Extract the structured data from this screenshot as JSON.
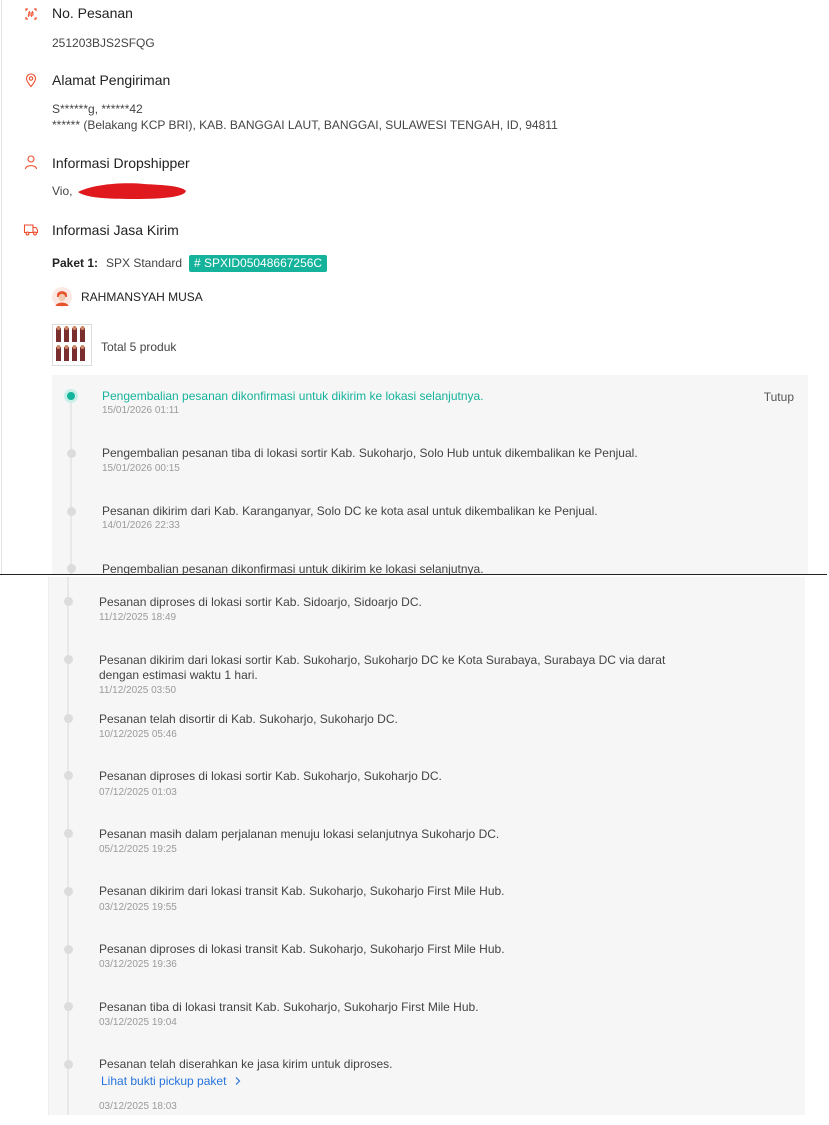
{
  "order": {
    "number_title": "No. Pesanan",
    "number_value": "251203BJS2SFQG",
    "address_title": "Alamat Pengiriman",
    "address_line1": "S******g, ******42",
    "address_line2": "****** (Belakang KCP BRI), KAB. BANGGAI LAUT, BANGGAI, SULAWESI TENGAH, ID, 94811",
    "dropship_title": "Informasi Dropshipper",
    "dropship_value": "Vio,",
    "shipping_title": "Informasi Jasa Kirim",
    "package_label": "Paket 1:",
    "courier": "SPX Standard",
    "tracking_tag": "# SPXID05048667256C",
    "driver_name": "RAHMANSYAH MUSA",
    "product_total": "Total 5 produk",
    "close_label": "Tutup"
  },
  "events_top": [
    {
      "title": "Pengembalian pesanan dikonfirmasi untuk dikirim ke lokasi selanjutnya.",
      "time": "15/01/2026 01:11"
    },
    {
      "title": "Pengembalian pesanan tiba di lokasi sortir Kab. Sukoharjo, Solo Hub untuk dikembalikan ke Penjual.",
      "time": "15/01/2026 00:15"
    },
    {
      "title": "Pesanan dikirim dari Kab. Karanganyar, Solo DC ke kota asal untuk dikembalikan ke Penjual.",
      "time": "14/01/2026 22:33"
    },
    {
      "title": "Pengembalian pesanan dikonfirmasi untuk dikirim ke lokasi selanjutnya.",
      "time": ""
    }
  ],
  "events_bottom": [
    {
      "title": "Pesanan diproses di lokasi sortir Kab. Sidoarjo, Sidoarjo DC.",
      "time": "11/12/2025 18:49"
    },
    {
      "title": "Pesanan dikirim dari lokasi sortir Kab. Sukoharjo, Sukoharjo DC ke Kota Surabaya, Surabaya DC via darat",
      "title2": "dengan estimasi waktu 1 hari.",
      "time": "11/12/2025 03:50"
    },
    {
      "title": "Pesanan telah disortir di Kab. Sukoharjo, Sukoharjo DC.",
      "time": "10/12/2025 05:46"
    },
    {
      "title": "Pesanan diproses di lokasi sortir Kab. Sukoharjo, Sukoharjo DC.",
      "time": "07/12/2025 01:03"
    },
    {
      "title": "Pesanan masih dalam perjalanan menuju lokasi selanjutnya Sukoharjo DC.",
      "time": "05/12/2025 19:25"
    },
    {
      "title": "Pesanan dikirim dari lokasi transit Kab. Sukoharjo, Sukoharjo First Mile Hub.",
      "time": "03/12/2025 19:55"
    },
    {
      "title": "Pesanan diproses di lokasi transit Kab. Sukoharjo, Sukoharjo First Mile Hub.",
      "time": "03/12/2025 19:36"
    },
    {
      "title": "Pesanan tiba di lokasi transit Kab. Sukoharjo, Sukoharjo First Mile Hub.",
      "time": "03/12/2025 19:04"
    },
    {
      "title": "Pesanan telah diserahkan ke jasa kirim untuk diproses.",
      "link": "Lihat bukti pickup paket",
      "time": "03/12/2025 18:03"
    }
  ],
  "colors": {
    "accent": "#15b39b",
    "brand": "#ee4d2d",
    "link": "#2673dd",
    "redaction": "#e0191f"
  },
  "icons": [
    "hash-icon",
    "location-pin-icon",
    "person-icon",
    "truck-icon",
    "chevron-right-icon"
  ]
}
